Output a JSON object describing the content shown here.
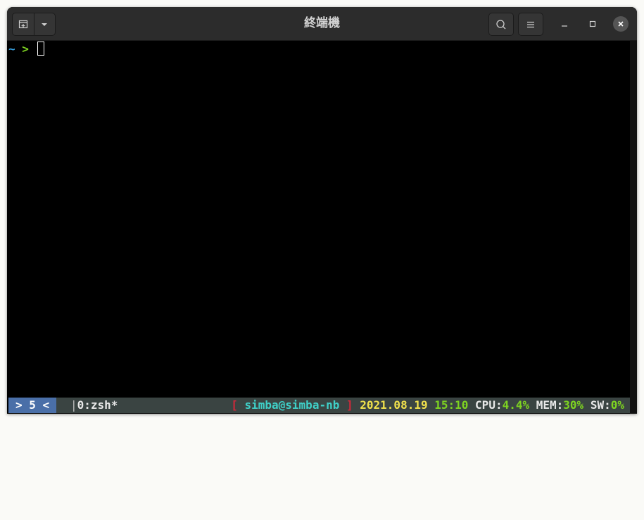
{
  "window": {
    "title": "終端機"
  },
  "titlebar": {
    "new_tab_icon": "new-tab-icon",
    "dropdown_icon": "chevron-down-icon",
    "search_icon": "search-icon",
    "menu_icon": "hamburger-menu-icon",
    "minimize_icon": "minimize-icon",
    "maximize_icon": "maximize-icon",
    "close_icon": "close-icon"
  },
  "terminal": {
    "prompt_dir": "~",
    "prompt_symbol": ">",
    "colors": {
      "dir": "#3aa6e8",
      "symbol": "#7ed321"
    }
  },
  "tmux": {
    "session": "> 5 <",
    "window_sep": "|",
    "window": "0:zsh*",
    "bracket_open": "[",
    "host": "simba@simba-nb",
    "bracket_close": "]",
    "date": "2021.08.19",
    "time": "15:10",
    "cpu_label": "CPU:",
    "cpu_value": "4.4%",
    "mem_label": "MEM:",
    "mem_value": "30%",
    "sw_label": "SW:",
    "sw_value": "0%",
    "colors": {
      "bar_bg": "#3a4442",
      "session_bg": "#4a6fa8",
      "bracket": "#d0283a",
      "host": "#3fd0c8",
      "date": "#f0e14c",
      "time": "#7ed321",
      "value": "#7ed321",
      "label": "#e8e8e8"
    }
  }
}
